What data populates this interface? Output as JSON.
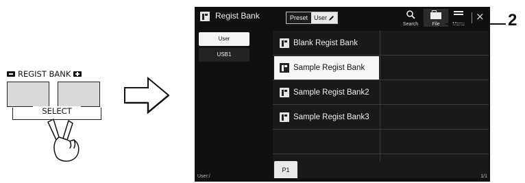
{
  "panel": {
    "regist_bank_label": "REGIST BANK",
    "select_label": "SELECT"
  },
  "screen": {
    "title": "Regist Bank",
    "segment": {
      "preset": "Preset",
      "user": "User"
    },
    "toolbar": {
      "search": "Search",
      "file": "File",
      "menu": "Menu"
    },
    "sidebar": [
      {
        "label": "User",
        "selected": true
      },
      {
        "label": "USB1",
        "selected": false
      }
    ],
    "items": [
      {
        "label": "Blank Regist Bank",
        "selected": false
      },
      {
        "label": "Sample Regist Bank",
        "selected": true
      },
      {
        "label": "Sample Regist Bank2",
        "selected": false
      },
      {
        "label": "Sample Regist Bank3",
        "selected": false
      }
    ],
    "page_tab": "P1",
    "status_path": "User:/",
    "page_count": "1/1"
  },
  "callout": {
    "number": "2"
  },
  "colors": {
    "screen_bg": "#101010",
    "selected_bg": "#f6f6f6"
  }
}
